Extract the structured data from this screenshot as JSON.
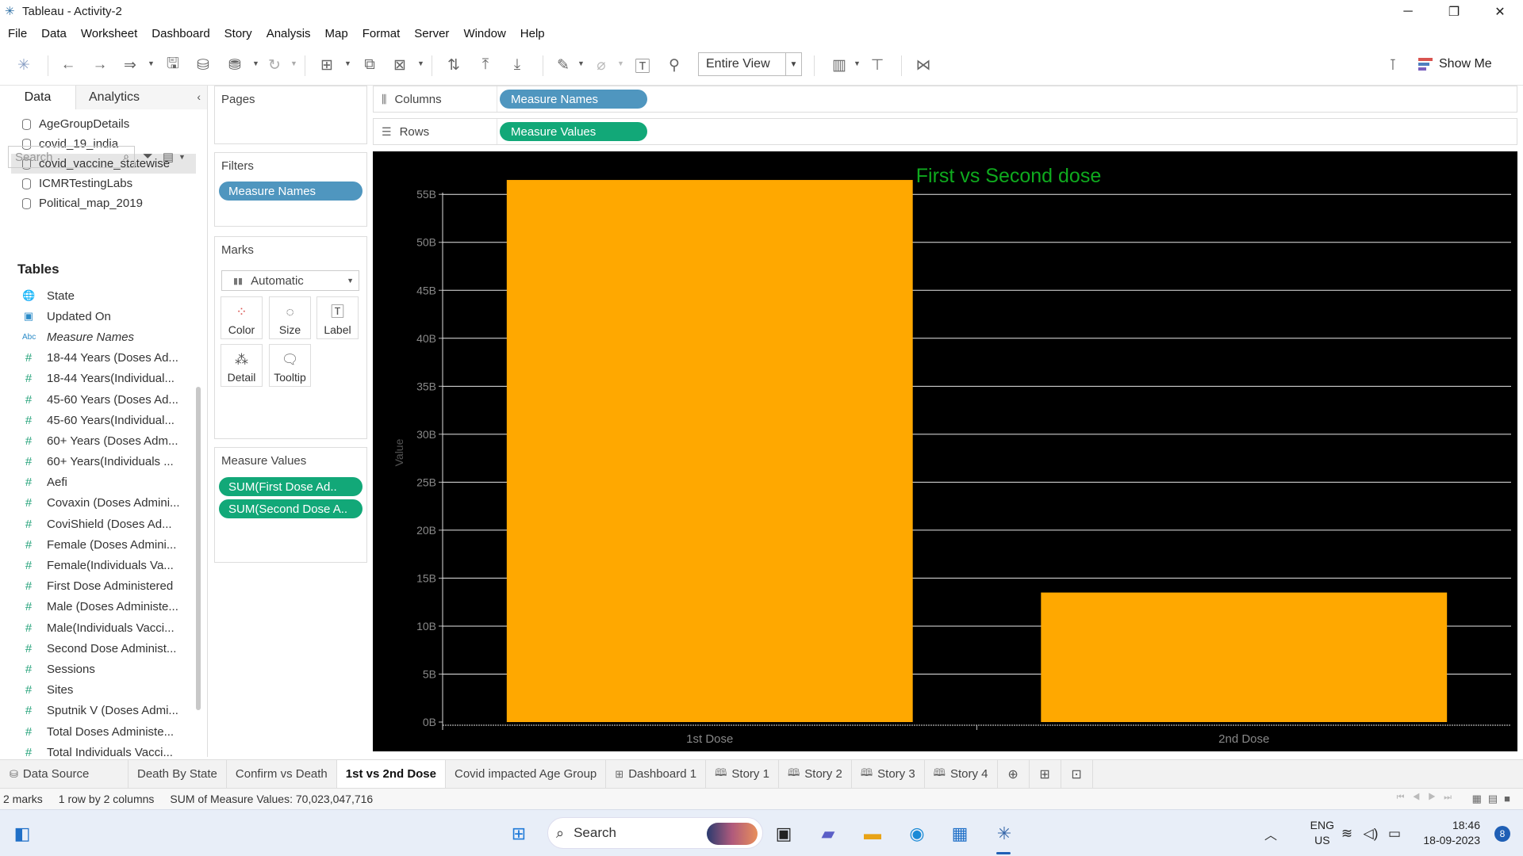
{
  "window": {
    "title": "Tableau - Activity-2"
  },
  "menu": [
    "File",
    "Data",
    "Worksheet",
    "Dashboard",
    "Story",
    "Analysis",
    "Map",
    "Format",
    "Server",
    "Window",
    "Help"
  ],
  "toolbar": {
    "fit": "Entire View",
    "show_me": "Show Me"
  },
  "data_pane": {
    "tabs": [
      "Data",
      "Analytics"
    ],
    "datasources": [
      "AgeGroupDetails",
      "covid_19_india",
      "covid_vaccine_statewise",
      "ICMRTestingLabs",
      "Political_map_2019"
    ],
    "active_datasource_index": 2,
    "search_placeholder": "Search",
    "tables_heading": "Tables",
    "fields": [
      {
        "name": "State",
        "type": "geo"
      },
      {
        "name": "Updated On",
        "type": "date"
      },
      {
        "name": "Measure Names",
        "type": "abc"
      },
      {
        "name": "18-44 Years (Doses Ad...",
        "type": "num"
      },
      {
        "name": "18-44 Years(Individual...",
        "type": "num"
      },
      {
        "name": "45-60 Years (Doses Ad...",
        "type": "num"
      },
      {
        "name": "45-60 Years(Individual...",
        "type": "num"
      },
      {
        "name": "60+ Years (Doses Adm...",
        "type": "num"
      },
      {
        "name": "60+ Years(Individuals ...",
        "type": "num"
      },
      {
        "name": "Aefi",
        "type": "num"
      },
      {
        "name": "Covaxin (Doses Admini...",
        "type": "num"
      },
      {
        "name": "CoviShield (Doses Ad...",
        "type": "num"
      },
      {
        "name": "Female (Doses Admini...",
        "type": "num"
      },
      {
        "name": "Female(Individuals Va...",
        "type": "num"
      },
      {
        "name": "First Dose Administered",
        "type": "num"
      },
      {
        "name": "Male (Doses Administe...",
        "type": "num"
      },
      {
        "name": "Male(Individuals Vacci...",
        "type": "num"
      },
      {
        "name": "Second Dose Administ...",
        "type": "num"
      },
      {
        "name": "Sessions",
        "type": "num"
      },
      {
        "name": "Sites",
        "type": "num"
      },
      {
        "name": "Sputnik V (Doses Admi...",
        "type": "num"
      },
      {
        "name": "Total Doses Administe...",
        "type": "num"
      },
      {
        "name": "Total Individuals Vacci...",
        "type": "num"
      }
    ]
  },
  "cards": {
    "pages": "Pages",
    "filters": "Filters",
    "filter_pill": "Measure Names",
    "marks": "Marks",
    "mark_type": "Automatic",
    "mark_buttons": [
      "Color",
      "Size",
      "Label",
      "Detail",
      "Tooltip"
    ],
    "measure_values": "Measure Values",
    "measure_pills": [
      "SUM(First Dose Ad..",
      "SUM(Second Dose A.."
    ]
  },
  "shelves": {
    "columns_label": "Columns",
    "columns_pill": "Measure Names",
    "rows_label": "Rows",
    "rows_pill": "Measure Values"
  },
  "chart_data": {
    "type": "bar",
    "title": "First vs Second dose",
    "xlabel": "",
    "ylabel": "Value",
    "categories": [
      "1st Dose",
      "2nd Dose"
    ],
    "values": [
      56.5,
      13.5
    ],
    "value_unit": "B",
    "ylim": [
      0,
      57
    ],
    "yticks": [
      "0B",
      "5B",
      "10B",
      "15B",
      "20B",
      "25B",
      "30B",
      "35B",
      "40B",
      "45B",
      "50B",
      "55B"
    ],
    "bar_color": "#FFA800",
    "background": "#000000",
    "title_color": "#0FAA1E",
    "grid": true
  },
  "sheet_tabs": {
    "data_source": "Data Source",
    "sheets": [
      "Death By State",
      "Confirm vs Death",
      "1st vs 2nd Dose",
      "Covid impacted Age Group"
    ],
    "active": "1st vs 2nd Dose",
    "dashboards": [
      "Dashboard 1"
    ],
    "stories": [
      "Story 1",
      "Story 2",
      "Story 3",
      "Story 4"
    ]
  },
  "status": {
    "marks": "2 marks",
    "dims": "1 row by 2 columns",
    "sum": "SUM of Measure Values: 70,023,047,716"
  },
  "taskbar": {
    "search": "Search",
    "lang1": "ENG",
    "lang2": "US",
    "time": "18:46",
    "date": "18-09-2023",
    "notifications": "8"
  }
}
